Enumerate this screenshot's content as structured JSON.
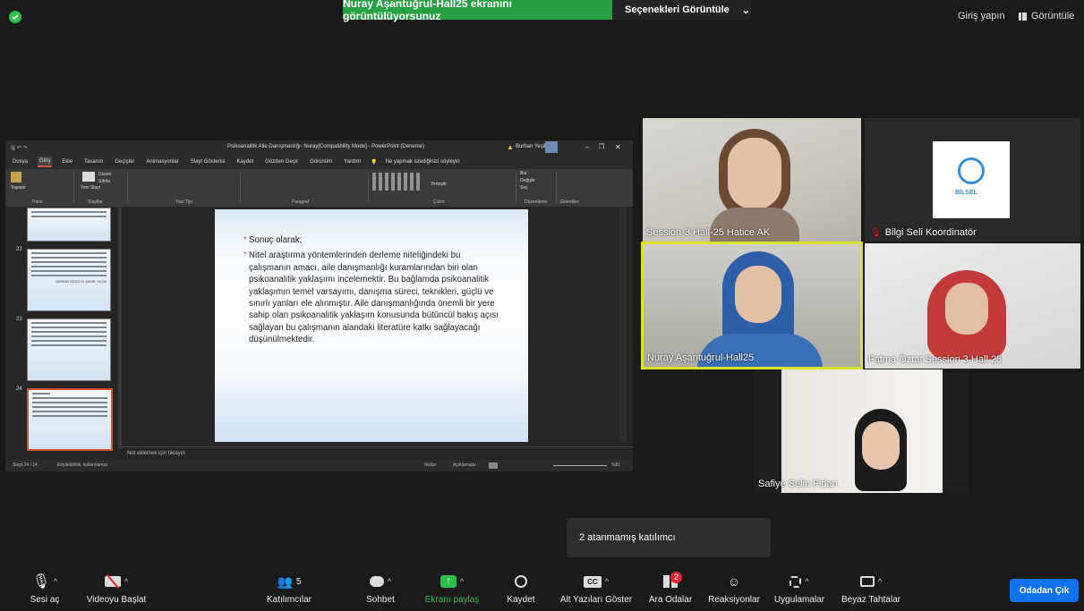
{
  "top_bar": {
    "share_banner": "Nuray Aşantuğrul-Hall25  ekranını görüntülüyorsunuz",
    "view_options": "Seçenekleri Görüntüle",
    "signin": "Giriş yapın",
    "view_label": "Görüntüle",
    "shield_color": "#2dbf4c"
  },
  "ppt": {
    "title": "Psikoanalitik Aile Danışmanlığı- Nuray[Compatibility Mode] - PowerPoint (Deneme)",
    "user": "Burhan Yeşil",
    "tabs": [
      "Dosya",
      "Giriş",
      "Ekle",
      "Tasarım",
      "Geçişler",
      "Animasyonlar",
      "Slayt Gösterisi",
      "Kaydet",
      "Gözden Geçir",
      "Görünüm",
      "Yardım"
    ],
    "search_hint": "Ne yapmak istediğinizi söyleyin",
    "ribbon_groups": [
      "Pano",
      "Slaytlar",
      "Yazı Tipi",
      "Paragraf",
      "Çizim",
      "Düzenleme",
      "Eklentiler"
    ],
    "ribbon_labels": {
      "paste": "Yapıştır",
      "new_slide": "Yeni Slayt",
      "layout": "Düzen",
      "reset": "Sıfırla",
      "arrange": "Yerleştir",
      "find": "Bul",
      "replace": "Değiştir",
      "select": "Seç"
    },
    "thumb_numbers": [
      "22",
      "23",
      "24"
    ],
    "thumb_text": "NURHAN GEZGİ VE ŞAHİN. YILDIZ",
    "slide_heading": "Sonuç olarak;",
    "slide_body": "Nitel araştırma yöntemlerinden derleme niteliğindeki bu çalışmanın amacı, aile danışmanlığı kuramlarından biri olan psikoanalitik yaklaşımı incelemektir. Bu bağlamda psikoanalitik yaklaşımın temel varsayımı, danışma süreci, teknikleri, güçlü ve sınırlı yanları ele alınmıştır. Aile danışmanlığında önemli bir yere sahip olan psikoanalitik yaklaşım konusunda bütüncül bakış açısı sağlayan bu çalışmanın alandaki literatüre katkı sağlayacağı düşünülmektedir.",
    "notes": "Not eklemek için tıklayın",
    "status_slide": "Slayt 24 / 24",
    "status_access": "Erişilebilirlik: kullanılamaz",
    "status_notes": "Notlar",
    "status_comments": "Açıklamalar",
    "zoom": "%81"
  },
  "videos": [
    {
      "name": "Session-3 Hall-25 Hatice AK"
    },
    {
      "name": "Bilgi Seli Koordinatör",
      "logo_text": "BİLSEL"
    },
    {
      "name": "Nuray Aşantuğrul-Hall25"
    },
    {
      "name": "Fatma Öztat Session 3 Hall 25"
    },
    {
      "name": "Safiye Selin Fidan"
    }
  ],
  "popup": {
    "unassigned": "2 atanmamış katılımcı"
  },
  "toolbar": {
    "unmute": "Sesi aç",
    "start_video": "Videoyu Başlat",
    "participants": "Katılımcılar",
    "participant_count": "5",
    "chat": "Sohbet",
    "share": "Ekranı paylaş",
    "record": "Kaydet",
    "captions": "Alt Yazıları Göster",
    "cc": "CC",
    "rooms": "Ara Odalar",
    "rooms_badge": "2",
    "reactions": "Reaksiyonlar",
    "apps": "Uygulamalar",
    "whiteboard": "Beyaz Tahtalar",
    "leave": "Odadan Çık"
  }
}
